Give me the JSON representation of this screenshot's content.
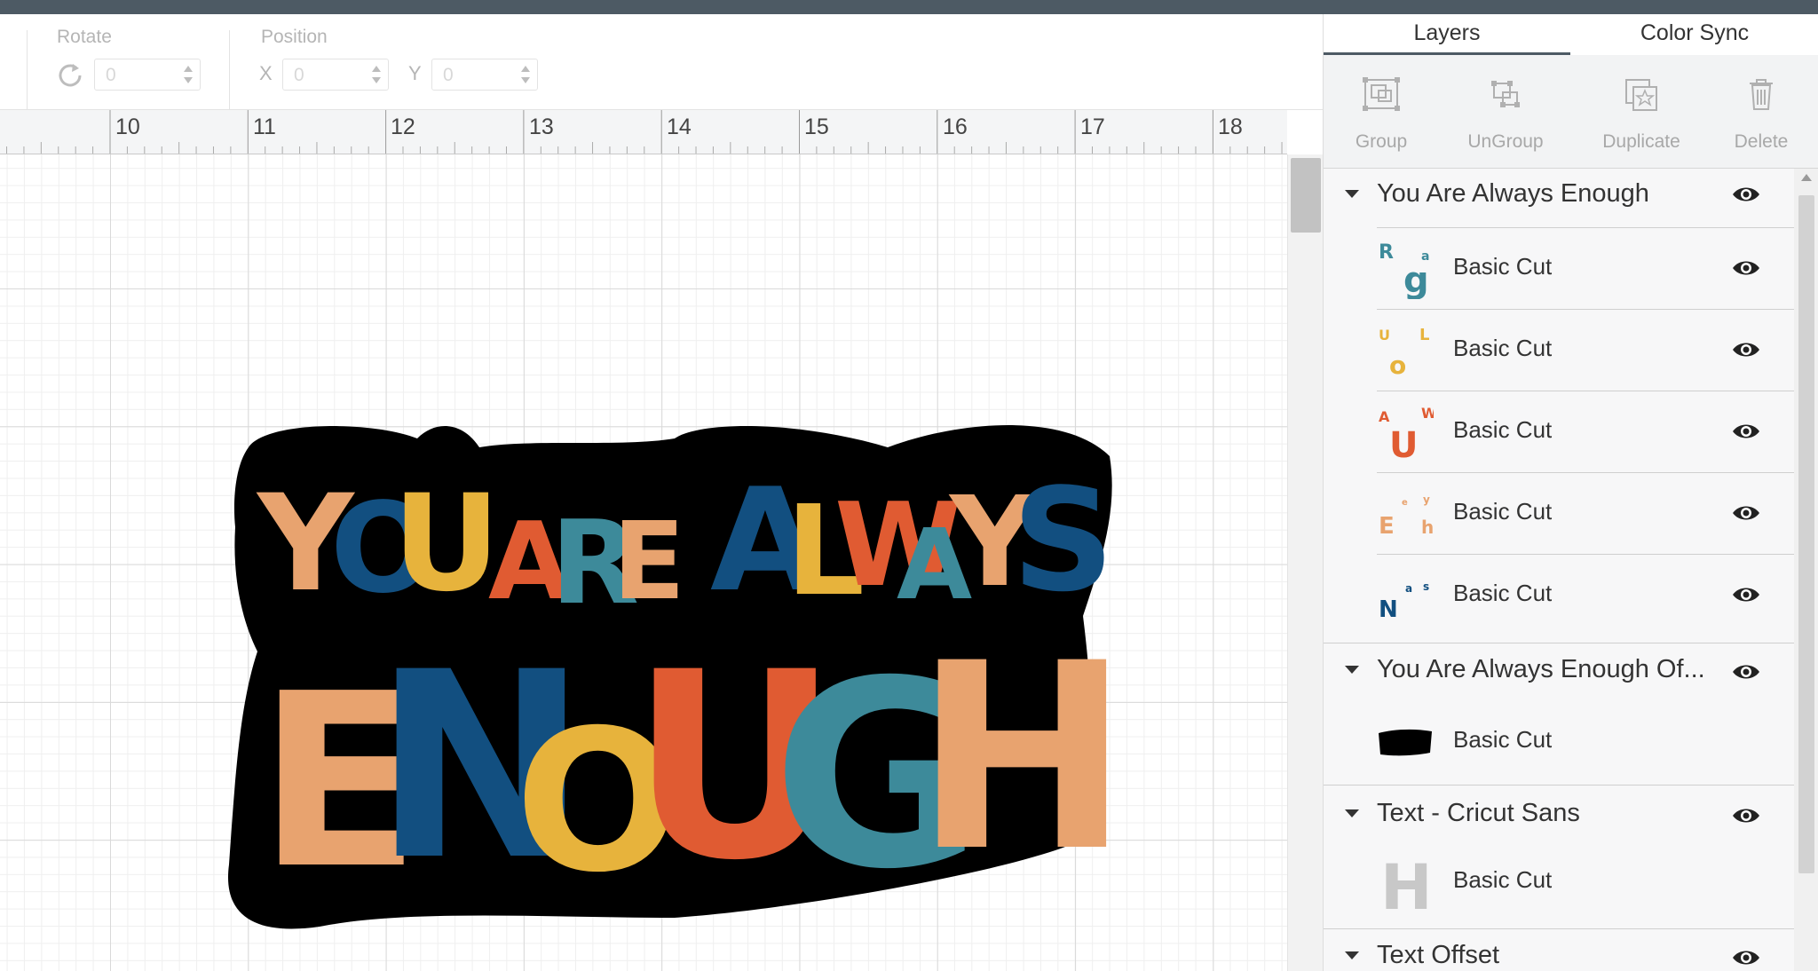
{
  "toolbar": {
    "rotate_label": "Rotate",
    "rotate_value": "0",
    "position_label": "Position",
    "x_label": "X",
    "x_value": "0",
    "y_label": "Y",
    "y_value": "0"
  },
  "ruler": {
    "ticks": [
      "10",
      "11",
      "12",
      "13",
      "14",
      "15",
      "16",
      "17",
      "18"
    ]
  },
  "design": {
    "line1": [
      "Y",
      "O",
      "U",
      "A",
      "R",
      "E",
      "A",
      "L",
      "W",
      "A",
      "Y",
      "S"
    ],
    "line2": [
      "E",
      "N",
      "O",
      "U",
      "G",
      "H"
    ],
    "colors": {
      "peach": "#e8a36f",
      "navy": "#124f80",
      "yellow": "#e7b33c",
      "orange": "#e05b32",
      "teal": "#3d8a9a",
      "outline": "#000000"
    }
  },
  "panel": {
    "tabs": [
      {
        "label": "Layers",
        "active": true
      },
      {
        "label": "Color Sync",
        "active": false
      }
    ],
    "actions": [
      {
        "label": "Group",
        "icon": "group-icon"
      },
      {
        "label": "UnGroup",
        "icon": "ungroup-icon"
      },
      {
        "label": "Duplicate",
        "icon": "duplicate-icon"
      },
      {
        "label": "Delete",
        "icon": "delete-icon"
      }
    ],
    "groups": [
      {
        "title": "You Are Always Enough",
        "children": [
          {
            "name": "Basic Cut",
            "thumb_letters": "R g a"
          },
          {
            "name": "Basic Cut",
            "thumb_letters": "U L o"
          },
          {
            "name": "Basic Cut",
            "thumb_letters": "A U W"
          },
          {
            "name": "Basic Cut",
            "thumb_letters": "E e y h"
          },
          {
            "name": "Basic Cut",
            "thumb_letters": "N a s"
          }
        ]
      },
      {
        "title": "You Are Always Enough Of...",
        "children": [
          {
            "name": "Basic Cut"
          }
        ]
      },
      {
        "title": "Text - Cricut Sans",
        "children": [
          {
            "name": "Basic Cut",
            "thumb_letters": "H"
          }
        ]
      },
      {
        "title": "Text Offset",
        "children": []
      }
    ]
  }
}
